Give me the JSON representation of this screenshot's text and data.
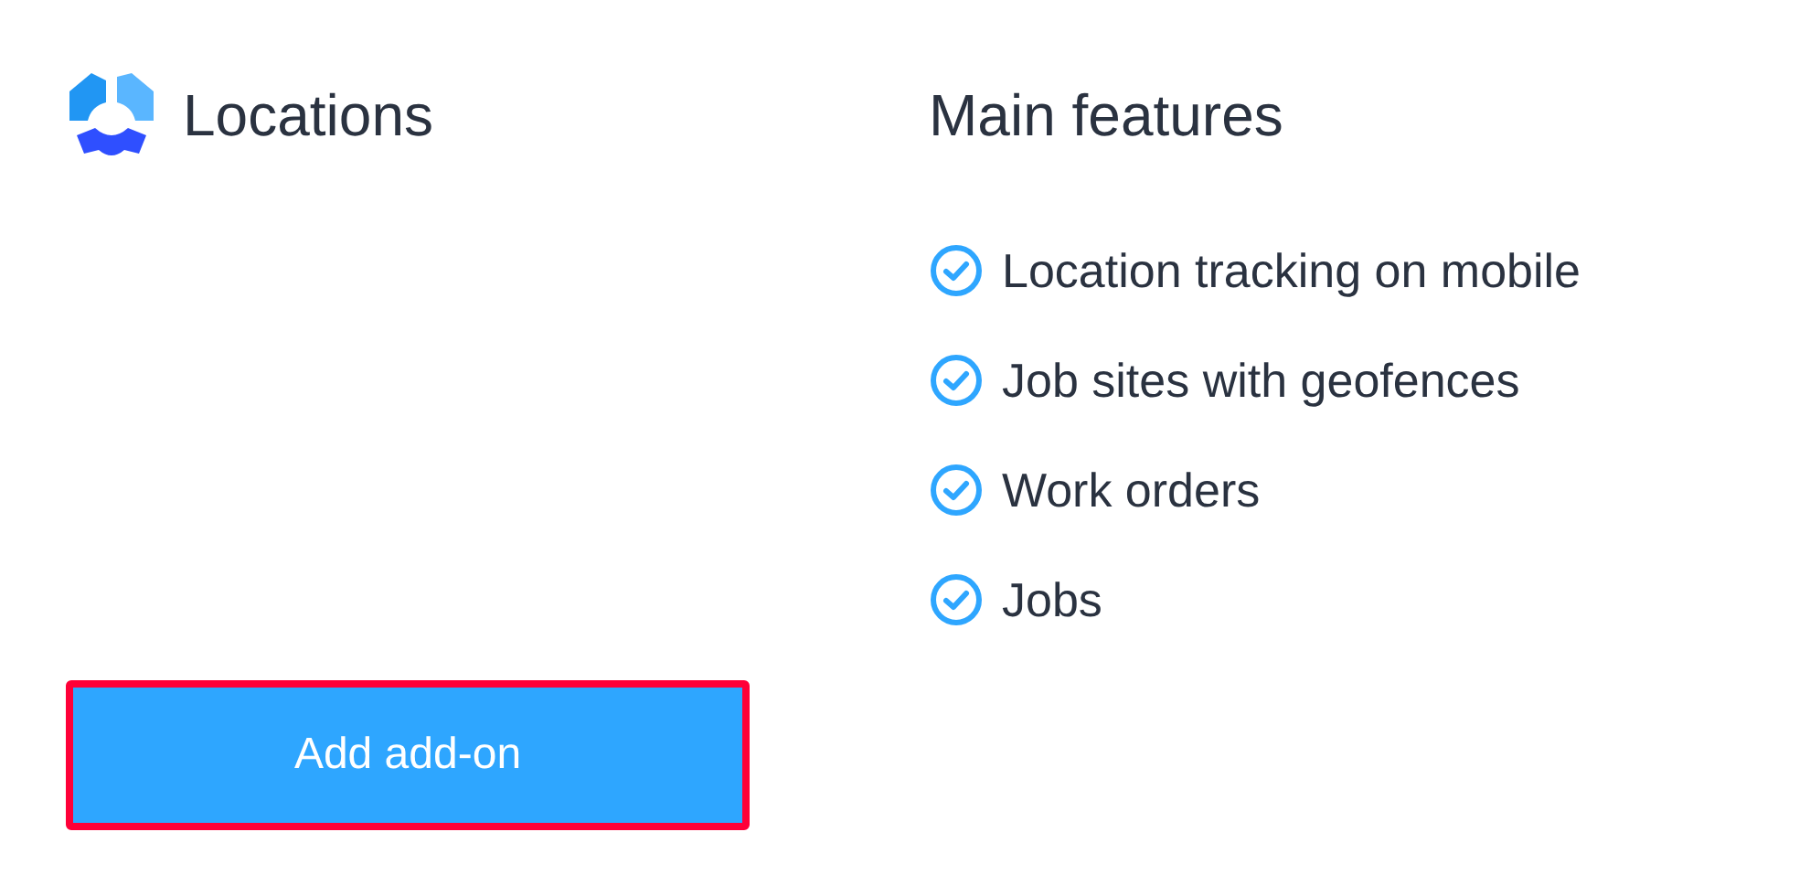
{
  "addon": {
    "title": "Locations",
    "button": {
      "label": "Add add-on",
      "highlighted": true
    }
  },
  "features": {
    "heading": "Main features",
    "items": [
      {
        "label": "Location tracking on mobile",
        "checked": true
      },
      {
        "label": "Job sites with geofences",
        "checked": true
      },
      {
        "label": "Work orders",
        "checked": true
      },
      {
        "label": "Jobs",
        "checked": true
      }
    ]
  }
}
